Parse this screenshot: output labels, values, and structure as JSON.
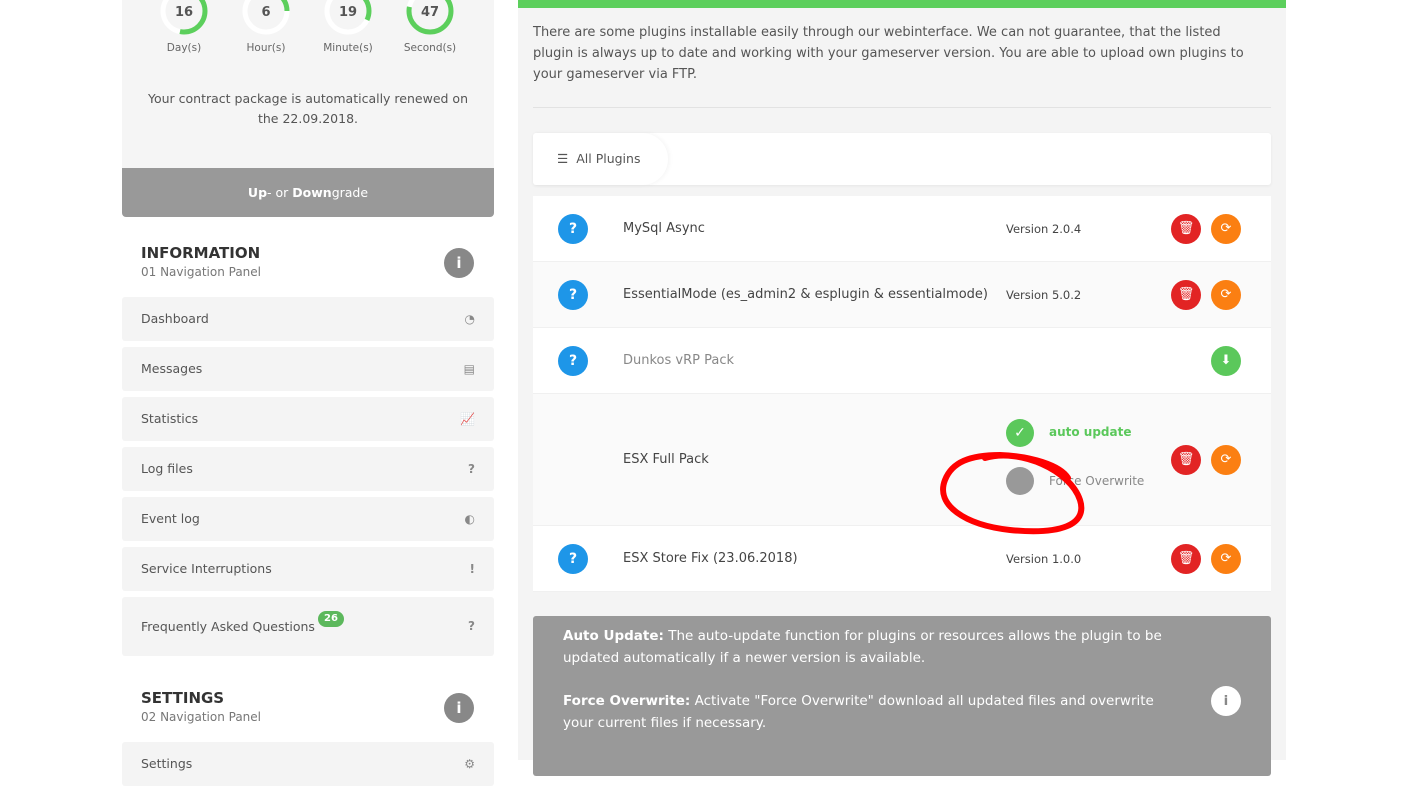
{
  "countdown": [
    {
      "value": "16",
      "label": "Day(s)",
      "fraction": 0.53
    },
    {
      "value": "6",
      "label": "Hour(s)",
      "fraction": 0.25
    },
    {
      "value": "19",
      "label": "Minute(s)",
      "fraction": 0.32
    },
    {
      "value": "47",
      "label": "Second(s)",
      "fraction": 0.78
    }
  ],
  "renew_text": "Your contract package is automatically renewed on the 22.09.2018.",
  "upgrade": {
    "up": "Up",
    "mid": "- or ",
    "down": "Down",
    "rest": "grade"
  },
  "information": {
    "title": "INFORMATION",
    "subtitle": "01 Navigation Panel"
  },
  "nav": [
    {
      "label": "Dashboard",
      "icon": "◔"
    },
    {
      "label": "Messages",
      "icon": "▤"
    },
    {
      "label": "Statistics",
      "icon": "📈"
    },
    {
      "label": "Log files",
      "icon": "?"
    },
    {
      "label": "Event log",
      "icon": "◐"
    },
    {
      "label": "Service Interruptions",
      "icon": "!"
    },
    {
      "label": "Frequently Asked Questions",
      "icon": "?",
      "badge": "26"
    }
  ],
  "settings": {
    "title": "SETTINGS",
    "subtitle": "02 Navigation Panel",
    "items": [
      {
        "label": "Settings",
        "icon": "⚙"
      }
    ]
  },
  "intro": "There are some plugins installable easily through our webinterface. We can not guarantee, that the listed plugin is always up to date and working with your gameserver version. You are able to upload own plugins to your gameserver via FTP.",
  "tab": "All Plugins",
  "plugins": [
    {
      "name": "MySql Async",
      "version": "Version 2.0.4"
    },
    {
      "name": "EssentialMode (es_admin2 & esplugin & essentialmode)",
      "version": "Version 5.0.2"
    },
    {
      "name": "Dunkos vRP Pack"
    },
    {
      "name": "ESX Full Pack",
      "auto_update": "auto update",
      "force_overwrite": "Force Overwrite"
    },
    {
      "name": "ESX Store Fix (23.06.2018)",
      "version": "Version 1.0.0"
    }
  ],
  "note": {
    "auto_title": "Auto Update:",
    "auto_text": " The auto-update function for plugins or resources allows the plugin to be updated automatically if a newer version is available.",
    "force_title": "Force Overwrite:",
    "force_text": " Activate \"Force Overwrite\" download all updated files and overwrite your current files if necessary."
  }
}
